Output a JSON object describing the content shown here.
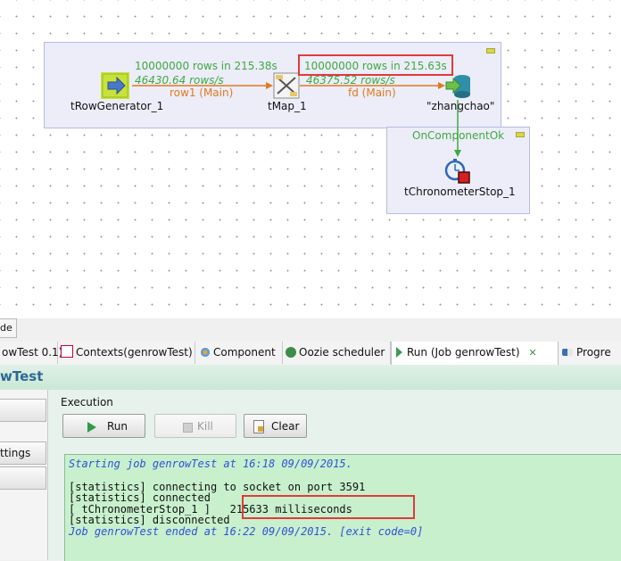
{
  "canvas": {
    "components": {
      "row_generator": "tRowGenerator_1",
      "tmap": "tMap_1",
      "db_output": "\"zhangchao\"",
      "chrono_stop": "tChronometerStop_1"
    },
    "links": {
      "row1": {
        "rows": "10000000 rows in 215.38s",
        "rate": "46430.64 rows/s",
        "label": "row1 (Main)"
      },
      "fd": {
        "rows": "10000000 rows in 215.63s",
        "rate": "46375.52 rows/s",
        "label": "fd (Main)"
      },
      "trigger": "OnComponentOk"
    }
  },
  "editor_tab": "de",
  "tabs": [
    {
      "label": "owTest 0.1)",
      "icon": "",
      "active": false
    },
    {
      "label": "Contexts(genrowTest)",
      "icon": "contexts-icon",
      "active": false
    },
    {
      "label": "Component",
      "icon": "component-icon",
      "active": false
    },
    {
      "label": "Oozie scheduler",
      "icon": "oozie-icon",
      "active": false
    },
    {
      "label": "Run (Job genrowTest)",
      "icon": "run-icon",
      "active": true,
      "close": "✕"
    },
    {
      "label": "Progre",
      "icon": "progress-icon",
      "active": false
    }
  ],
  "panel_title": "wTest",
  "left_buttons": [
    "",
    "ttings",
    ""
  ],
  "execution": {
    "label": "Execution",
    "run": "Run",
    "kill": "Kill",
    "clear": "Clear"
  },
  "console": [
    {
      "text": "Starting job genrowTest at 16:18 09/09/2015.",
      "style": "blue"
    },
    {
      "text": "",
      "style": "normal"
    },
    {
      "text": "[statistics] connecting to socket on port 3591",
      "style": "normal"
    },
    {
      "text": "[statistics] connected",
      "style": "normal"
    },
    {
      "text": "[ tChronometerStop_1 ]   215633 milliseconds",
      "style": "normal"
    },
    {
      "text": "[statistics] disconnected",
      "style": "normal"
    },
    {
      "text": "Job genrowTest ended at 16:22 09/09/2015. [exit code=0]",
      "style": "blue"
    }
  ],
  "colors": {
    "highlight": "#e23a3a",
    "stat_green": "#3fa83f",
    "link_orange": "#e07a1f",
    "console_bg": "#c8f0cd",
    "console_blue": "#3050d8",
    "title_blue": "#2d6a93"
  }
}
